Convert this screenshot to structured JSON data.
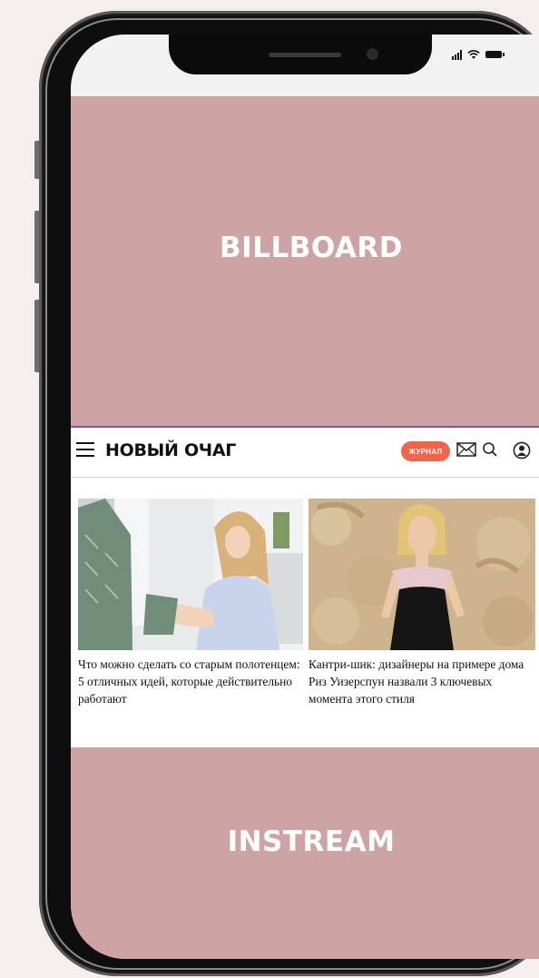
{
  "statusbar": {
    "signal_icon": "signal-bars-icon",
    "wifi_icon": "wifi-icon",
    "battery_icon": "battery-icon"
  },
  "billboard": {
    "label": "BILLBOARD"
  },
  "header": {
    "logo": "НОВЫЙ ОЧАГ",
    "badge": "ЖУРНАЛ",
    "badge_color": "#f0644a"
  },
  "articles": [
    {
      "title": "Что можно сделать со старым полотенцем: 5 отличных идей, которые действительно работают"
    },
    {
      "title": "Кантри-шик: дизайнеры на примере дома Риз Уизерспун назвали 3 ключевых момента этого стиля"
    }
  ],
  "instream": {
    "label": "INSTREAM"
  },
  "colors": {
    "ad_background": "#cda3a3",
    "page_background": "#f6eeee",
    "accent_line": "#7a55b5"
  }
}
